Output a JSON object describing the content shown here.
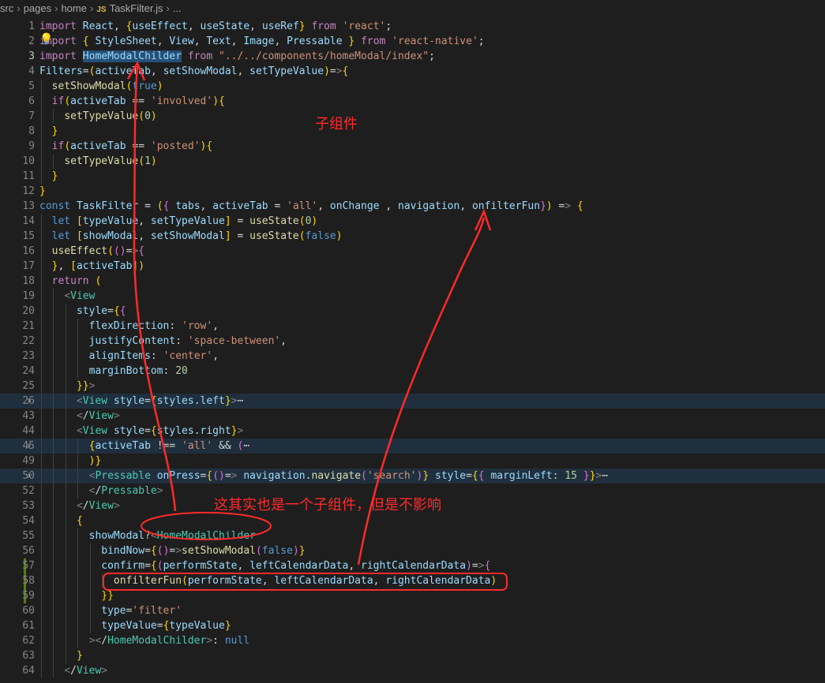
{
  "breadcrumb": {
    "segments": [
      "src",
      "pages",
      "home"
    ],
    "file_icon": "JS",
    "file": "TaskFilter.js",
    "tail": "..."
  },
  "editor": {
    "lines": [
      {
        "n": "1",
        "t": "import React, {useEffect, useState, useRef} from 'react';"
      },
      {
        "n": "2",
        "t": "import { StyleSheet, View, Text, Image, Pressable } from 'react-native';"
      },
      {
        "n": "3",
        "t": "import HomeModalChilder from \"../../components/homeModal/index\";"
      },
      {
        "n": "4",
        "t": "Filters=(activeTab, setShowModal, setTypeValue)=>{"
      },
      {
        "n": "5",
        "t": "  setShowModal(true)"
      },
      {
        "n": "6",
        "t": "  if(activeTab == 'involved'){"
      },
      {
        "n": "7",
        "t": "    setTypeValue(0)"
      },
      {
        "n": "8",
        "t": "  }"
      },
      {
        "n": "9",
        "t": "  if(activeTab == 'posted'){"
      },
      {
        "n": "10",
        "t": "    setTypeValue(1)"
      },
      {
        "n": "11",
        "t": "  }"
      },
      {
        "n": "12",
        "t": "}"
      },
      {
        "n": "13",
        "t": "const TaskFilter = ({ tabs, activeTab = 'all', onChange , navigation, onfilterFun}) => {"
      },
      {
        "n": "14",
        "t": "  let [typeValue, setTypeValue] = useState(0)"
      },
      {
        "n": "15",
        "t": "  let [showModal, setShowModal] = useState(false)"
      },
      {
        "n": "16",
        "t": "  useEffect(()=>{"
      },
      {
        "n": "17",
        "t": "  }, [activeTab])"
      },
      {
        "n": "18",
        "t": "  return ("
      },
      {
        "n": "19",
        "t": "    <View"
      },
      {
        "n": "20",
        "t": "      style={{"
      },
      {
        "n": "21",
        "t": "        flexDirection: 'row',"
      },
      {
        "n": "22",
        "t": "        justifyContent: 'space-between',"
      },
      {
        "n": "23",
        "t": "        alignItems: 'center',"
      },
      {
        "n": "24",
        "t": "        marginBottom: 20"
      },
      {
        "n": "25",
        "t": "      }}>"
      },
      {
        "n": "26",
        "t": "      <View style={styles.left}>⋯"
      },
      {
        "n": "43",
        "t": "      </View>"
      },
      {
        "n": "44",
        "t": "      <View style={styles.right}>"
      },
      {
        "n": "45",
        "t": "        {activeTab !== 'all' && (⋯"
      },
      {
        "n": "49",
        "t": "        )}"
      },
      {
        "n": "50",
        "t": "        <Pressable onPress={()=> navigation.navigate('search')} style={{ marginLeft: 15 }}>⋯"
      },
      {
        "n": "52",
        "t": "        </Pressable>"
      },
      {
        "n": "53",
        "t": "      </View>"
      },
      {
        "n": "54",
        "t": "      {"
      },
      {
        "n": "55",
        "t": "        showModal?<HomeModalChilder"
      },
      {
        "n": "56",
        "t": "          bindNow={()=>setShowModal(false)}"
      },
      {
        "n": "57",
        "t": "          confirm={(performState, leftCalendarData, rightCalendarData)=>{"
      },
      {
        "n": "58",
        "t": "            onfilterFun(performState, leftCalendarData, rightCalendarData)"
      },
      {
        "n": "59",
        "t": "          }}"
      },
      {
        "n": "60",
        "t": "          type='filter'"
      },
      {
        "n": "61",
        "t": "          typeValue={typeValue}"
      },
      {
        "n": "62",
        "t": "        ></HomeModalChilder>: null"
      },
      {
        "n": "63",
        "t": "      }"
      },
      {
        "n": "64",
        "t": "    </View>"
      }
    ]
  },
  "annotations": {
    "child_component": "子组件",
    "also_child": "这其实也是一个子组件，但是不影响",
    "color": "#ff2a2a"
  }
}
